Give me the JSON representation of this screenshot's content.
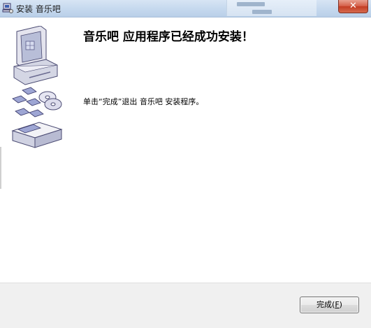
{
  "window": {
    "title": "安装 音乐吧",
    "close_glyph": "✕"
  },
  "main": {
    "heading": "音乐吧 应用程序已经成功安装！",
    "message": "单击“完成”退出 音乐吧 安装程序。"
  },
  "footer": {
    "finish_prefix": "完成(",
    "finish_accel": "F",
    "finish_suffix": ")"
  },
  "icons": {
    "app": "installer-computer-icon",
    "illustration": "computer-discs-box-illustration"
  }
}
